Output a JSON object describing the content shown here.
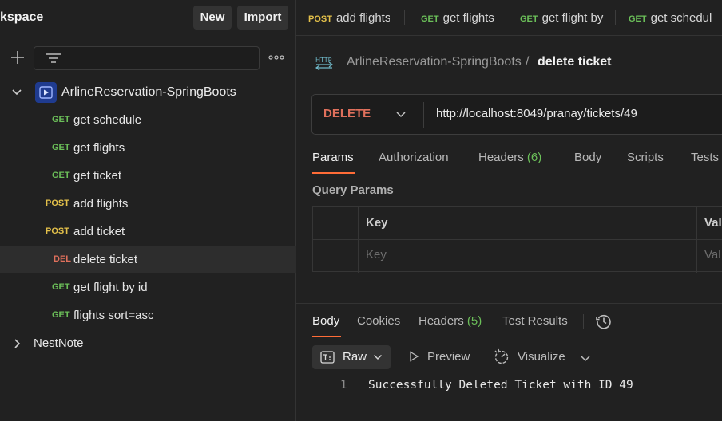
{
  "workspace": {
    "title": "kspace",
    "new_label": "New",
    "import_label": "Import"
  },
  "collections": [
    {
      "name": "ArlineReservation-SpringBoots",
      "requests": [
        {
          "method": "GET",
          "name": "get schedule"
        },
        {
          "method": "GET",
          "name": "get flights"
        },
        {
          "method": "GET",
          "name": "get ticket"
        },
        {
          "method": "POST",
          "name": "add flights"
        },
        {
          "method": "POST",
          "name": "add ticket"
        },
        {
          "method": "DEL",
          "name": "delete ticket",
          "selected": true
        },
        {
          "method": "GET",
          "name": "get flight by id"
        },
        {
          "method": "GET",
          "name": "flights sort=asc"
        }
      ]
    },
    {
      "name": "NestNote"
    }
  ],
  "tabs": [
    {
      "method": "POST",
      "name": "add flights"
    },
    {
      "method": "GET",
      "name": "get flights"
    },
    {
      "method": "GET",
      "name": "get flight by"
    },
    {
      "method": "GET",
      "name": "get schedul"
    }
  ],
  "breadcrumb": {
    "collection": "ArlineReservation-SpringBoots",
    "separator": "/",
    "current": "delete ticket"
  },
  "request": {
    "method": "DELETE",
    "url": "http://localhost:8049/pranay/tickets/49"
  },
  "request_tabs": {
    "params": "Params",
    "authorization": "Authorization",
    "headers": "Headers",
    "headers_count": "(6)",
    "body": "Body",
    "scripts": "Scripts",
    "tests": "Tests"
  },
  "query_params": {
    "title": "Query Params",
    "key_header": "Key",
    "value_header": "Val",
    "key_placeholder": "Key",
    "value_placeholder": "Val"
  },
  "response": {
    "tabs": {
      "body": "Body",
      "cookies": "Cookies",
      "headers": "Headers",
      "headers_count": "(5)",
      "test_results": "Test Results"
    },
    "format": "Raw",
    "preview": "Preview",
    "visualize": "Visualize",
    "line_number": "1",
    "body_text": "Successfully Deleted Ticket with ID 49"
  },
  "colors": {
    "get": "#6bbf59",
    "post": "#e3c04a",
    "delete": "#e0705c",
    "accent": "#ff6c37"
  },
  "icons": [
    "plus-icon",
    "filter-icon",
    "more-icon",
    "chevron-down-icon",
    "collection-icon",
    "chevron-right-icon",
    "http-icon",
    "history-icon",
    "raw-icon",
    "play-icon",
    "visualize-icon"
  ]
}
